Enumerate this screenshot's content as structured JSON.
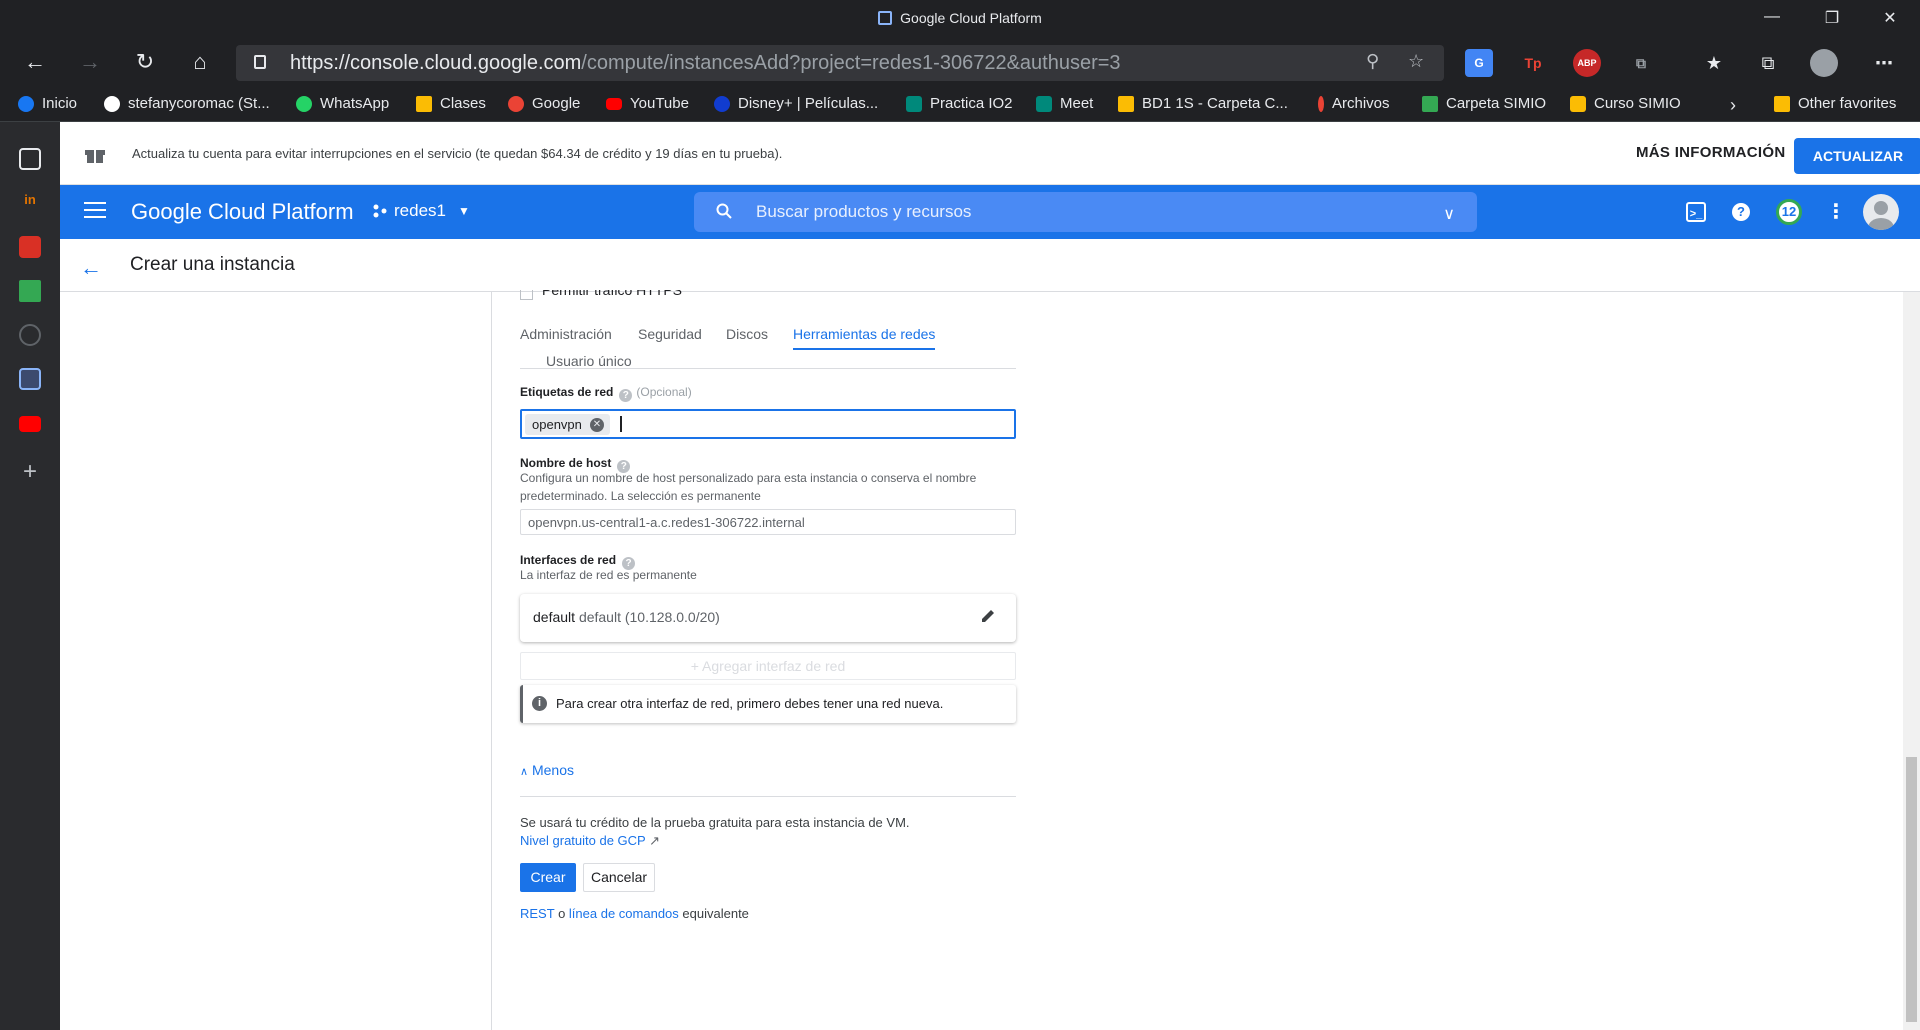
{
  "window": {
    "title": "Google Cloud Platform"
  },
  "browser": {
    "url_main": "https://console.cloud.google.com",
    "url_rest": "/compute/instancesAdd?project=redes1-306722&authuser=3",
    "bookmarks": [
      {
        "label": "Inicio",
        "color": "#1877f2"
      },
      {
        "label": "stefanycoromac (St...",
        "color": "#ffffff"
      },
      {
        "label": "WhatsApp",
        "color": "#25d366"
      },
      {
        "label": "Clases",
        "color": "#fbbc04"
      },
      {
        "label": "Google",
        "color": "#ea4335"
      },
      {
        "label": "YouTube",
        "color": "#ff0000"
      },
      {
        "label": "Disney+ | Películas...",
        "color": "#113ccf"
      },
      {
        "label": "Practica IO2",
        "color": "#00897b"
      },
      {
        "label": "Meet",
        "color": "#00897b"
      },
      {
        "label": "BD1 1S - Carpeta C...",
        "color": "#fbbc04"
      },
      {
        "label": "Archivos",
        "color": "#ea4335"
      },
      {
        "label": "Carpeta SIMIO",
        "color": "#34a853"
      },
      {
        "label": "Curso SIMIO",
        "color": "#fbbc04"
      }
    ],
    "other_favorites": "Other favorites"
  },
  "promo": {
    "message": "Actualiza tu cuenta para evitar interrupciones en el servicio (te quedan $64.34 de crédito y 19 días en tu prueba).",
    "more_label": "MÁS INFORMACIÓN",
    "upgrade_label": "ACTUALIZAR"
  },
  "gcp": {
    "brand": "Google Cloud Platform",
    "project": "redes1",
    "search_placeholder": "Buscar productos y recursos",
    "notifications": "12"
  },
  "page": {
    "title": "Crear una instancia",
    "https_checkbox": "Permitir tráfico HTTPS",
    "tabs": [
      "Administración",
      "Seguridad",
      "Discos",
      "Herramientas de redes",
      "Usuario único"
    ],
    "network_tags_label": "Etiquetas de red",
    "optional": "(Opcional)",
    "tag_chip": "openvpn",
    "hostname_label": "Nombre de host",
    "hostname_hint": "Configura un nombre de host personalizado para esta instancia o conserva el nombre predeterminado. La selección es permanente",
    "hostname_value": "openvpn.us-central1-a.c.redes1-306722.internal",
    "interfaces_label": "Interfaces de red",
    "interfaces_hint": "La interfaz de red es permanente",
    "interface_name": "default",
    "interface_detail": "default (10.128.0.0/20)",
    "add_interface": "Agregar interfaz de red",
    "note": "Para crear otra interfaz de red, primero debes tener una red nueva.",
    "less": "Menos",
    "credit_text": "Se usará tu crédito de la prueba gratuita para esta instancia de VM.",
    "free_tier_link": "Nivel gratuito de GCP",
    "create": "Crear",
    "cancel": "Cancelar",
    "rest": "REST",
    "or": "o",
    "cmdline": "línea de comandos",
    "equivalent": "equivalente"
  }
}
